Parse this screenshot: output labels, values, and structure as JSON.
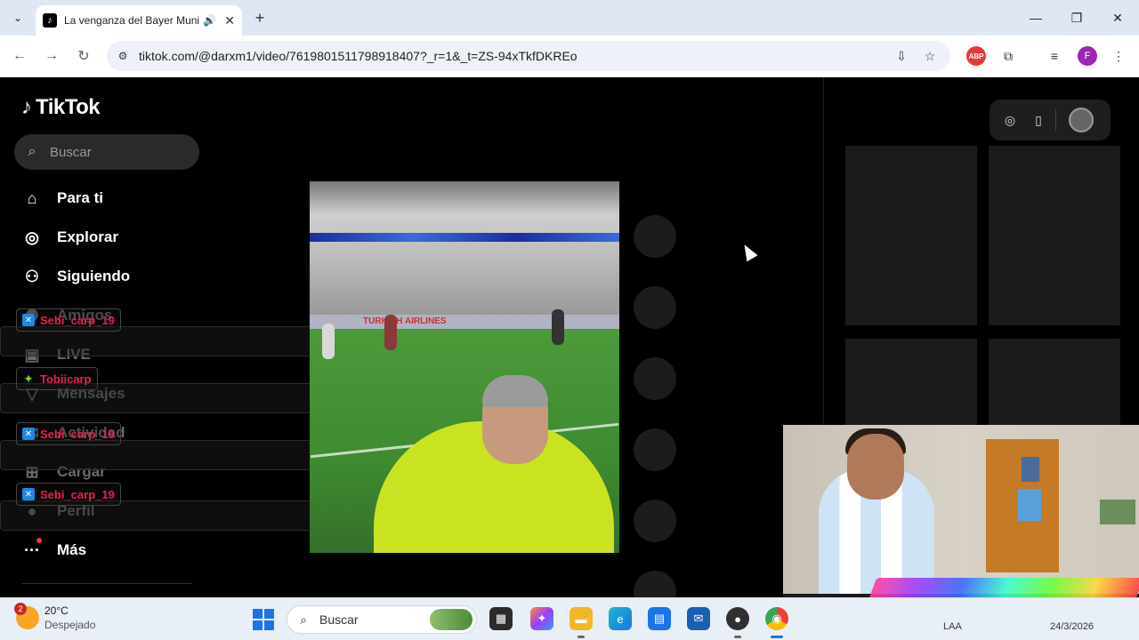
{
  "browser": {
    "tab_title": "La venganza del Bayer Munich",
    "url": "tiktok.com/@darxm1/video/7619801511798918407?_r=1&_t=ZS-94xTkfDKREo",
    "profile_initial": "F",
    "adblock_label": "ABP"
  },
  "tiktok": {
    "logo_text": "TikTok",
    "search_placeholder": "Buscar",
    "nav": {
      "for_you": "Para ti",
      "explore": "Explorar",
      "following": "Siguiendo",
      "friends": "Amigos",
      "live": "LIVE",
      "messages": "Mensajes",
      "activity": "Actividad",
      "upload": "Cargar",
      "profile": "Perfil",
      "more": "Más"
    }
  },
  "overlay": {
    "tag1": "Sebi_carp_19",
    "tag2": "Tobiicarp",
    "tag3": "Sebi_carp_19",
    "tag4": "Sebi_carp_19"
  },
  "video": {
    "ad_text": "TURKISH AIRLINES"
  },
  "taskbar": {
    "temperature": "20°C",
    "weather_desc": "Despejado",
    "weather_badge": "2",
    "search_label": "Buscar",
    "tray_lang": "LAA",
    "tray_date": "24/3/2026"
  }
}
